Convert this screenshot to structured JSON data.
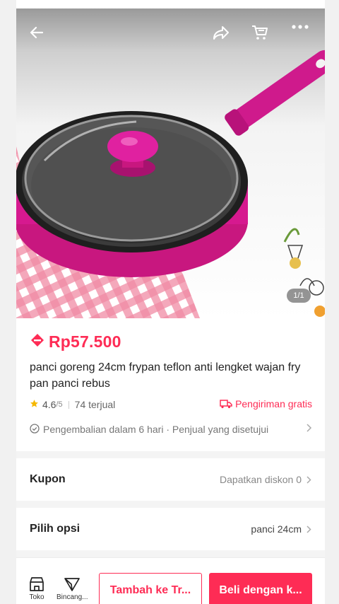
{
  "hero": {
    "image_counter": "1/1",
    "icons": [
      "back-arrow-icon",
      "share-icon",
      "cart-icon",
      "more-icon"
    ]
  },
  "product": {
    "price": "Rp57.500",
    "title": "panci goreng 24cm frypan teflon anti lengket wajan fry pan panci rebus",
    "rating": "4.6",
    "rating_max": "/5",
    "sold": "74 terjual",
    "shipping": "Pengiriman gratis",
    "returns": "Pengembalian dalam 6 hari · Penjual yang disetujui"
  },
  "coupon": {
    "label": "Kupon",
    "value": "Dapatkan diskon 0"
  },
  "options": {
    "label": "Pilih opsi",
    "value": "panci 24cm"
  },
  "bottom_bar": {
    "shop_label": "Toko",
    "chat_label": "Bincang...",
    "add_to_cart": "Tambah ke Tr...",
    "buy_now": "Beli dengan k..."
  },
  "colors": {
    "accent": "#fe2c55",
    "star": "#f5b800",
    "pan": "#d6198f"
  }
}
